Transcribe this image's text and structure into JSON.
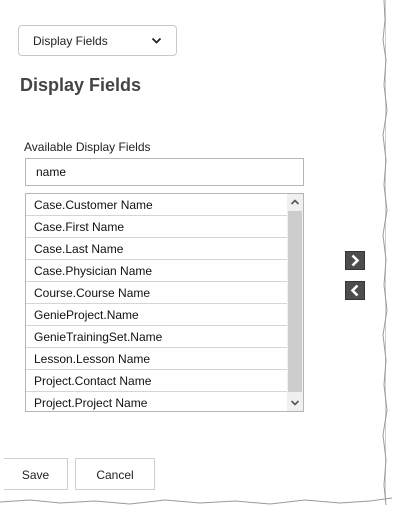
{
  "view_select": {
    "selected": "Display Fields"
  },
  "page_title": "Display Fields",
  "available": {
    "label": "Available Display Fields",
    "search_value": "name",
    "items": [
      "Case.Customer Name",
      "Case.First Name",
      "Case.Last Name",
      "Case.Physician Name",
      "Course.Course Name",
      "GenieProject.Name",
      "GenieTrainingSet.Name",
      "Lesson.Lesson Name",
      "Project.Contact Name",
      "Project.Project Name"
    ]
  },
  "transfer": {
    "add_icon": "chevron-right-icon",
    "remove_icon": "chevron-left-icon"
  },
  "footer": {
    "save_label": "Save",
    "cancel_label": "Cancel"
  },
  "colors": {
    "transfer_button": "#4d4d4d",
    "scroll_thumb": "#cdcdcd",
    "title_text": "#444444"
  }
}
